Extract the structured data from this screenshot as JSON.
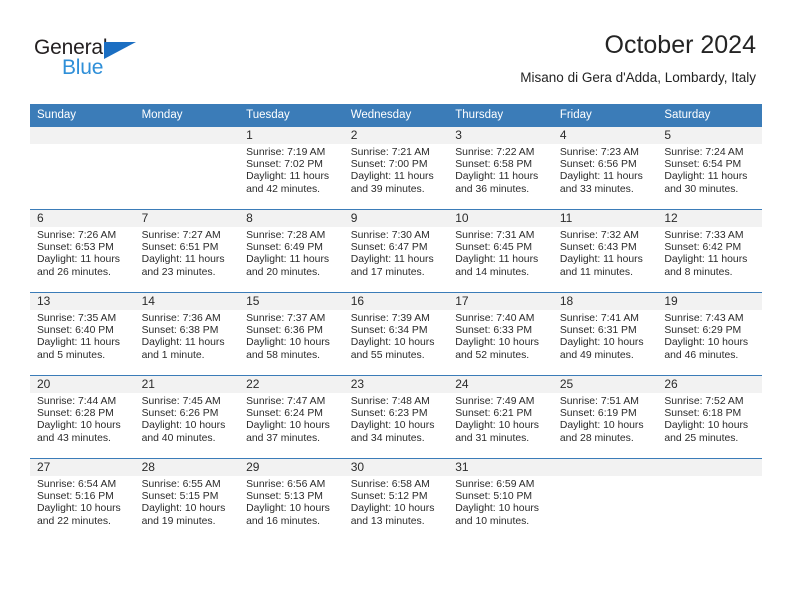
{
  "brand": {
    "name_part1": "General",
    "name_part2": "Blue",
    "accent_color": "#2f8fd8",
    "triangle_color": "#1b6ec2"
  },
  "header": {
    "title": "October 2024",
    "subtitle": "Misano di Gera d'Adda, Lombardy, Italy",
    "header_bg": "#3b7cb8"
  },
  "calendar": {
    "weekdays": [
      "Sunday",
      "Monday",
      "Tuesday",
      "Wednesday",
      "Thursday",
      "Friday",
      "Saturday"
    ],
    "weeks": [
      [
        {
          "day": "",
          "sunrise": "",
          "sunset": "",
          "daylight_line1": "",
          "daylight_line2": "",
          "empty": true
        },
        {
          "day": "",
          "sunrise": "",
          "sunset": "",
          "daylight_line1": "",
          "daylight_line2": "",
          "empty": true
        },
        {
          "day": "1",
          "sunrise": "Sunrise: 7:19 AM",
          "sunset": "Sunset: 7:02 PM",
          "daylight_line1": "Daylight: 11 hours",
          "daylight_line2": "and 42 minutes."
        },
        {
          "day": "2",
          "sunrise": "Sunrise: 7:21 AM",
          "sunset": "Sunset: 7:00 PM",
          "daylight_line1": "Daylight: 11 hours",
          "daylight_line2": "and 39 minutes."
        },
        {
          "day": "3",
          "sunrise": "Sunrise: 7:22 AM",
          "sunset": "Sunset: 6:58 PM",
          "daylight_line1": "Daylight: 11 hours",
          "daylight_line2": "and 36 minutes."
        },
        {
          "day": "4",
          "sunrise": "Sunrise: 7:23 AM",
          "sunset": "Sunset: 6:56 PM",
          "daylight_line1": "Daylight: 11 hours",
          "daylight_line2": "and 33 minutes."
        },
        {
          "day": "5",
          "sunrise": "Sunrise: 7:24 AM",
          "sunset": "Sunset: 6:54 PM",
          "daylight_line1": "Daylight: 11 hours",
          "daylight_line2": "and 30 minutes."
        }
      ],
      [
        {
          "day": "6",
          "sunrise": "Sunrise: 7:26 AM",
          "sunset": "Sunset: 6:53 PM",
          "daylight_line1": "Daylight: 11 hours",
          "daylight_line2": "and 26 minutes."
        },
        {
          "day": "7",
          "sunrise": "Sunrise: 7:27 AM",
          "sunset": "Sunset: 6:51 PM",
          "daylight_line1": "Daylight: 11 hours",
          "daylight_line2": "and 23 minutes."
        },
        {
          "day": "8",
          "sunrise": "Sunrise: 7:28 AM",
          "sunset": "Sunset: 6:49 PM",
          "daylight_line1": "Daylight: 11 hours",
          "daylight_line2": "and 20 minutes."
        },
        {
          "day": "9",
          "sunrise": "Sunrise: 7:30 AM",
          "sunset": "Sunset: 6:47 PM",
          "daylight_line1": "Daylight: 11 hours",
          "daylight_line2": "and 17 minutes."
        },
        {
          "day": "10",
          "sunrise": "Sunrise: 7:31 AM",
          "sunset": "Sunset: 6:45 PM",
          "daylight_line1": "Daylight: 11 hours",
          "daylight_line2": "and 14 minutes."
        },
        {
          "day": "11",
          "sunrise": "Sunrise: 7:32 AM",
          "sunset": "Sunset: 6:43 PM",
          "daylight_line1": "Daylight: 11 hours",
          "daylight_line2": "and 11 minutes."
        },
        {
          "day": "12",
          "sunrise": "Sunrise: 7:33 AM",
          "sunset": "Sunset: 6:42 PM",
          "daylight_line1": "Daylight: 11 hours",
          "daylight_line2": "and 8 minutes."
        }
      ],
      [
        {
          "day": "13",
          "sunrise": "Sunrise: 7:35 AM",
          "sunset": "Sunset: 6:40 PM",
          "daylight_line1": "Daylight: 11 hours",
          "daylight_line2": "and 5 minutes."
        },
        {
          "day": "14",
          "sunrise": "Sunrise: 7:36 AM",
          "sunset": "Sunset: 6:38 PM",
          "daylight_line1": "Daylight: 11 hours",
          "daylight_line2": "and 1 minute."
        },
        {
          "day": "15",
          "sunrise": "Sunrise: 7:37 AM",
          "sunset": "Sunset: 6:36 PM",
          "daylight_line1": "Daylight: 10 hours",
          "daylight_line2": "and 58 minutes."
        },
        {
          "day": "16",
          "sunrise": "Sunrise: 7:39 AM",
          "sunset": "Sunset: 6:34 PM",
          "daylight_line1": "Daylight: 10 hours",
          "daylight_line2": "and 55 minutes."
        },
        {
          "day": "17",
          "sunrise": "Sunrise: 7:40 AM",
          "sunset": "Sunset: 6:33 PM",
          "daylight_line1": "Daylight: 10 hours",
          "daylight_line2": "and 52 minutes."
        },
        {
          "day": "18",
          "sunrise": "Sunrise: 7:41 AM",
          "sunset": "Sunset: 6:31 PM",
          "daylight_line1": "Daylight: 10 hours",
          "daylight_line2": "and 49 minutes."
        },
        {
          "day": "19",
          "sunrise": "Sunrise: 7:43 AM",
          "sunset": "Sunset: 6:29 PM",
          "daylight_line1": "Daylight: 10 hours",
          "daylight_line2": "and 46 minutes."
        }
      ],
      [
        {
          "day": "20",
          "sunrise": "Sunrise: 7:44 AM",
          "sunset": "Sunset: 6:28 PM",
          "daylight_line1": "Daylight: 10 hours",
          "daylight_line2": "and 43 minutes."
        },
        {
          "day": "21",
          "sunrise": "Sunrise: 7:45 AM",
          "sunset": "Sunset: 6:26 PM",
          "daylight_line1": "Daylight: 10 hours",
          "daylight_line2": "and 40 minutes."
        },
        {
          "day": "22",
          "sunrise": "Sunrise: 7:47 AM",
          "sunset": "Sunset: 6:24 PM",
          "daylight_line1": "Daylight: 10 hours",
          "daylight_line2": "and 37 minutes."
        },
        {
          "day": "23",
          "sunrise": "Sunrise: 7:48 AM",
          "sunset": "Sunset: 6:23 PM",
          "daylight_line1": "Daylight: 10 hours",
          "daylight_line2": "and 34 minutes."
        },
        {
          "day": "24",
          "sunrise": "Sunrise: 7:49 AM",
          "sunset": "Sunset: 6:21 PM",
          "daylight_line1": "Daylight: 10 hours",
          "daylight_line2": "and 31 minutes."
        },
        {
          "day": "25",
          "sunrise": "Sunrise: 7:51 AM",
          "sunset": "Sunset: 6:19 PM",
          "daylight_line1": "Daylight: 10 hours",
          "daylight_line2": "and 28 minutes."
        },
        {
          "day": "26",
          "sunrise": "Sunrise: 7:52 AM",
          "sunset": "Sunset: 6:18 PM",
          "daylight_line1": "Daylight: 10 hours",
          "daylight_line2": "and 25 minutes."
        }
      ],
      [
        {
          "day": "27",
          "sunrise": "Sunrise: 6:54 AM",
          "sunset": "Sunset: 5:16 PM",
          "daylight_line1": "Daylight: 10 hours",
          "daylight_line2": "and 22 minutes."
        },
        {
          "day": "28",
          "sunrise": "Sunrise: 6:55 AM",
          "sunset": "Sunset: 5:15 PM",
          "daylight_line1": "Daylight: 10 hours",
          "daylight_line2": "and 19 minutes."
        },
        {
          "day": "29",
          "sunrise": "Sunrise: 6:56 AM",
          "sunset": "Sunset: 5:13 PM",
          "daylight_line1": "Daylight: 10 hours",
          "daylight_line2": "and 16 minutes."
        },
        {
          "day": "30",
          "sunrise": "Sunrise: 6:58 AM",
          "sunset": "Sunset: 5:12 PM",
          "daylight_line1": "Daylight: 10 hours",
          "daylight_line2": "and 13 minutes."
        },
        {
          "day": "31",
          "sunrise": "Sunrise: 6:59 AM",
          "sunset": "Sunset: 5:10 PM",
          "daylight_line1": "Daylight: 10 hours",
          "daylight_line2": "and 10 minutes."
        },
        {
          "day": "",
          "sunrise": "",
          "sunset": "",
          "daylight_line1": "",
          "daylight_line2": "",
          "empty": true
        },
        {
          "day": "",
          "sunrise": "",
          "sunset": "",
          "daylight_line1": "",
          "daylight_line2": "",
          "empty": true
        }
      ]
    ]
  }
}
